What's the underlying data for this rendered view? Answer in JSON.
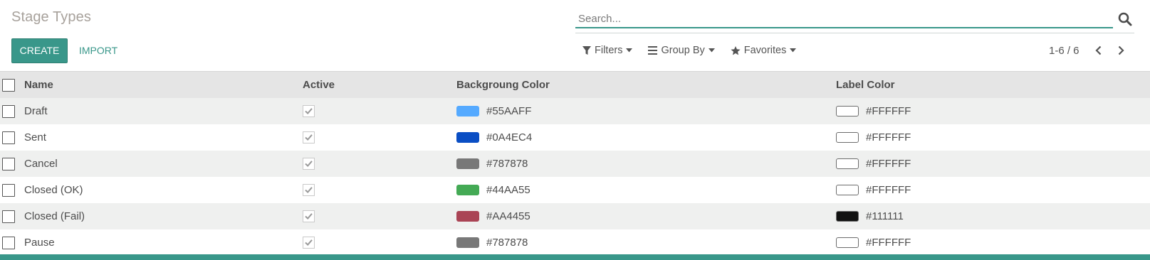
{
  "header": {
    "breadcrumb": "Stage Types"
  },
  "buttons": {
    "create_label": "CREATE",
    "import_label": "IMPORT"
  },
  "search": {
    "placeholder": "Search...",
    "value": ""
  },
  "filters": {
    "filters_label": "Filters",
    "group_by_label": "Group By",
    "favorites_label": "Favorites"
  },
  "pager": {
    "value": "1-6 / 6"
  },
  "table": {
    "headers": {
      "name": "Name",
      "active": "Active",
      "background_color": "Backgroung Color",
      "label_color": "Label Color"
    },
    "rows": [
      {
        "name": "Draft",
        "active": true,
        "bg_color": "#55AAFF",
        "label_color": "#FFFFFF"
      },
      {
        "name": "Sent",
        "active": true,
        "bg_color": "#0A4EC4",
        "label_color": "#FFFFFF"
      },
      {
        "name": "Cancel",
        "active": true,
        "bg_color": "#787878",
        "label_color": "#FFFFFF"
      },
      {
        "name": "Closed (OK)",
        "active": true,
        "bg_color": "#44AA55",
        "label_color": "#FFFFFF"
      },
      {
        "name": "Closed (Fail)",
        "active": true,
        "bg_color": "#AA4455",
        "label_color": "#111111"
      },
      {
        "name": "Pause",
        "active": true,
        "bg_color": "#787878",
        "label_color": "#FFFFFF"
      }
    ]
  },
  "theme": {
    "accent": "#39978A"
  }
}
